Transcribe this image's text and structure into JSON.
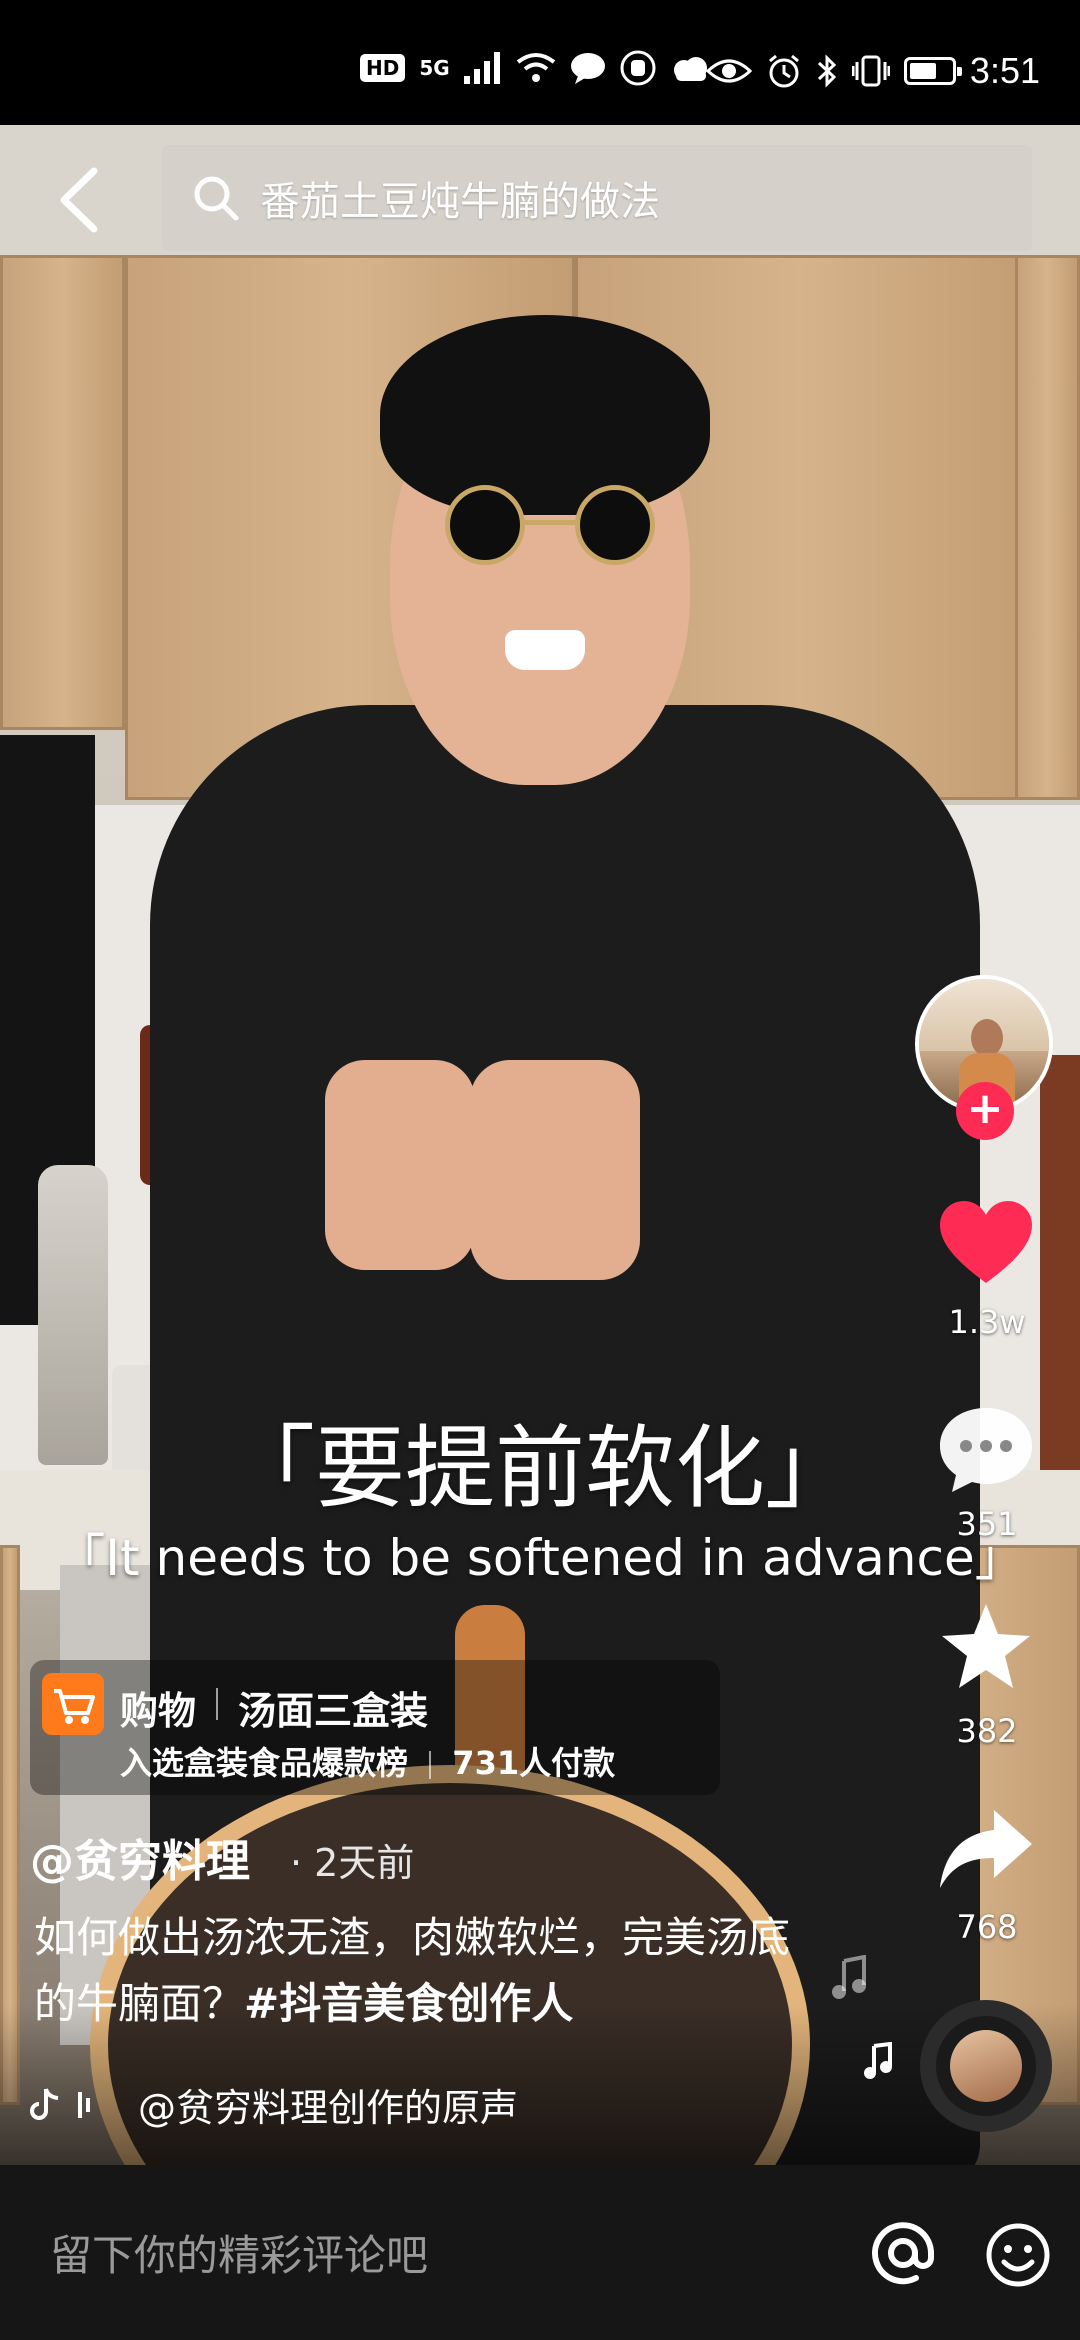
{
  "status_bar": {
    "hd": "HD",
    "network": "5G",
    "time": "3:51",
    "battery_level": 0.65
  },
  "search": {
    "query": "番茄土豆炖牛腩的做法"
  },
  "rail": {
    "likes": "1.3w",
    "comments": "351",
    "favorites": "382",
    "shares": "768",
    "accent": "#fe2c55"
  },
  "subtitles": {
    "cn": "「要提前软化」",
    "en": "「It needs to be softened in advance」"
  },
  "shop": {
    "label": "购物",
    "title": "汤面三盒装",
    "sub1": "入选盒装食品爆款榜",
    "sub2": "731人付款"
  },
  "post": {
    "author": "@贫穷料理",
    "time": "· 2天前",
    "desc": "如何做出汤浓无渣，肉嫩软烂，完美汤底的牛腩面？",
    "hashtag": "#抖音美食创作人",
    "music": "@贫穷料理创作的原声"
  },
  "comment": {
    "placeholder": "留下你的精彩评论吧"
  }
}
